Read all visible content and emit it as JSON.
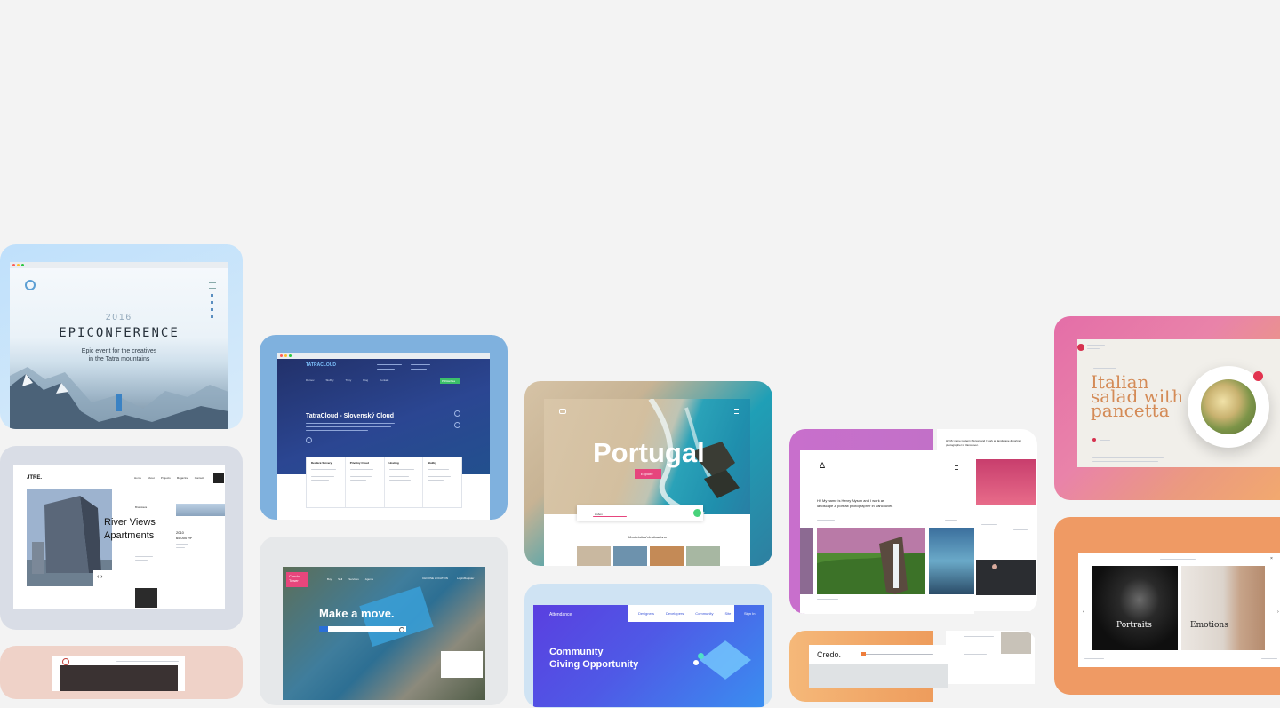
{
  "epic": {
    "year": "2016",
    "title": "EPICONFERENCE",
    "subtitle_1": "Epic event for the creatives",
    "subtitle_2": "in the Tatra mountains"
  },
  "jtre": {
    "logo": "JTRE.",
    "nav": [
      "Home",
      "About",
      "Projects",
      "Magazine",
      "Contact"
    ],
    "headline_1": "River Views",
    "headline_2": "Apartments",
    "tag": "Bratislava",
    "stat_1": "2010",
    "stat_2": "65.000 m²",
    "arrows": "‹ ›"
  },
  "tatra": {
    "logo": "TATRACLOUD",
    "nav": [
      "Domov",
      "Služby",
      "Tímy",
      "Blog",
      "Kontakt"
    ],
    "cta": "Prihlásiť sa",
    "headline": "TatraCloud - Slovenský Cloud",
    "columns": [
      "Dedikcé Servery",
      "Privátny Cloud",
      "Hosting",
      "Služby"
    ]
  },
  "portugal": {
    "title": "Portugal",
    "button": "Explore",
    "search_value": "Lisbon",
    "section_title": "Most visited destinations"
  },
  "henry": {
    "logo": "ᐃ",
    "intro_1": "Hi! My name is Henry Alyson and I work as",
    "intro_2": "landscape & portrait photographer in Vancouver.",
    "side_intro": "Hi! My name is Henry Alyson and I work as landscape & portrait photographer in Vancouver."
  },
  "salad": {
    "title_1": "Italian",
    "title_2": "salad with",
    "title_3": "pancetta"
  },
  "photo": {
    "label_1": "Portraits",
    "label_2": "Emotions"
  },
  "move": {
    "logo_1": "Condo",
    "logo_2": "Tower",
    "headline": "Make a move.",
    "nav": [
      "Buy",
      "Sell",
      "Services",
      "Agents"
    ],
    "pill": "CHOOSE LOCATION",
    "action": "Login/Register"
  },
  "attendance": {
    "logo": "Attendance",
    "tabs": [
      "Designers",
      "Developers",
      "Community",
      "Site"
    ],
    "signin": "Sign In",
    "headline_1": "Community",
    "headline_2": "Giving Opportunity"
  },
  "credo": {
    "logo": "Credo."
  },
  "colors": {
    "page_bg": "#f3f3f3",
    "epic_frame": "#cbe4fa",
    "jtre_frame": "#d9dde6",
    "tatra_frame": "#7fb1de",
    "tatra_dark": "#21336a",
    "portugal_teal": "#2ea8b6",
    "portugal_pink": "#e6457d",
    "henry_frame": "#c86fcc",
    "salad_frame": "#e57ab2",
    "salad_orange": "#e38c52",
    "photo_frame": "#ef9a64",
    "move_pink": "#e8467c",
    "attendance_blue": "#4b4be0",
    "credo_orange": "#f2a25d"
  },
  "icons": [
    "close-icon",
    "menu-icon",
    "chevron-left-icon",
    "chevron-right-icon",
    "search-icon"
  ]
}
